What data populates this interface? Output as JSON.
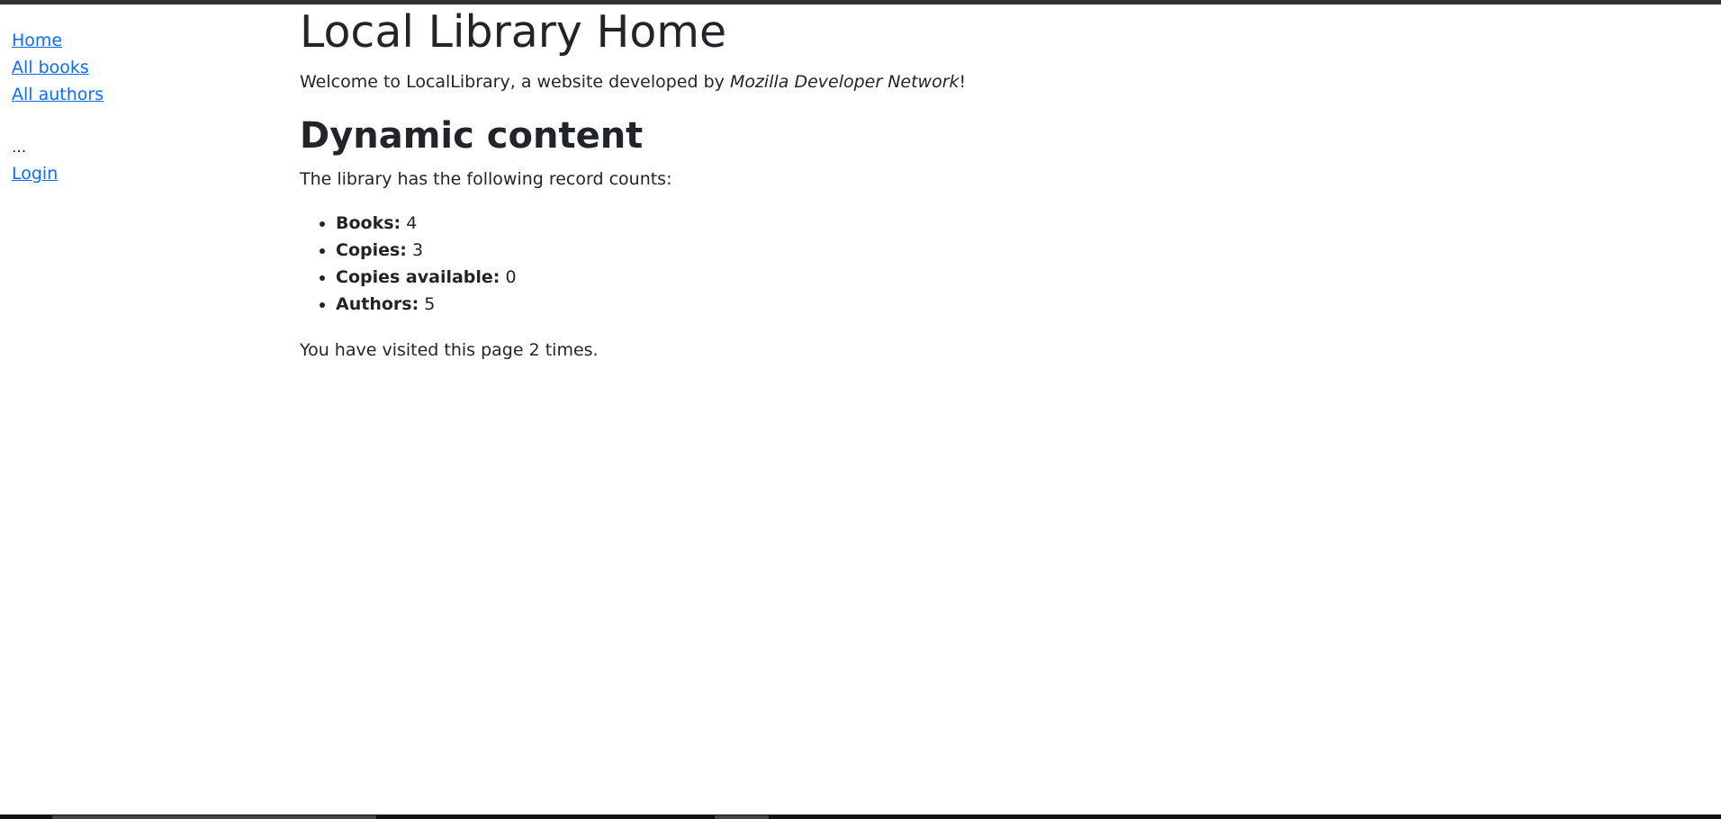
{
  "sidebar": {
    "links": [
      "Home",
      "All books",
      "All authors"
    ],
    "ellipsis": "...",
    "login": "Login"
  },
  "main": {
    "title": "Local Library Home",
    "welcome_prefix": "Welcome to LocalLibrary, a website developed by ",
    "welcome_emphasis": "Mozilla Developer Network",
    "welcome_suffix": "!",
    "subtitle": "Dynamic content",
    "intro": "The library has the following record counts:",
    "counts": [
      {
        "label": "Books:",
        "value": "4"
      },
      {
        "label": "Copies:",
        "value": "3"
      },
      {
        "label": "Copies available:",
        "value": "0"
      },
      {
        "label": "Authors:",
        "value": "5"
      }
    ],
    "visits": "You have visited this page 2 times."
  },
  "colors": {
    "link": "#0d6efd",
    "text": "#212529",
    "top_bar": "#333333"
  }
}
